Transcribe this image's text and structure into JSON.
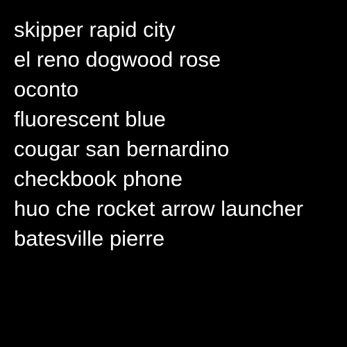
{
  "lines": [
    "skipper rapid city",
    "el reno dogwood rose",
    "oconto",
    "fluorescent blue",
    "cougar san bernardino",
    "checkbook phone",
    "huo che rocket arrow launcher",
    "batesville pierre"
  ],
  "colors": {
    "background": "#000000",
    "text": "#ffffff"
  }
}
